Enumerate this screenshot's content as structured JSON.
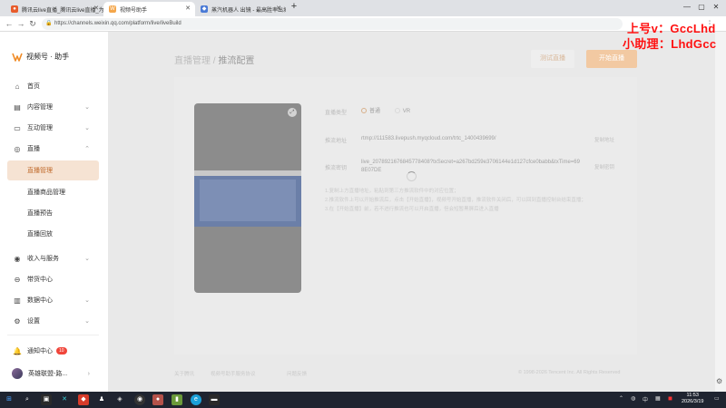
{
  "browser": {
    "tabs": [
      {
        "title": "腾讯云live直播_腾讯云live直播_为",
        "active": false
      },
      {
        "title": "视频号助手",
        "active": true
      },
      {
        "title": "蒸汽机器人 出镜 - 最高胜率出城",
        "active": false
      }
    ],
    "new_tab": "+",
    "url": "https://channels.weixin.qq.com/platform/live/liveBuild"
  },
  "overlay": {
    "line1": "上号v：GccLhd",
    "line2": "小助理：LhdGcc"
  },
  "sidebar": {
    "brand": "视频号 · 助手",
    "items": [
      {
        "label": "首页",
        "icon": "home-icon"
      },
      {
        "label": "内容管理",
        "icon": "content-icon"
      },
      {
        "label": "互动管理",
        "icon": "interaction-icon"
      },
      {
        "label": "直播",
        "icon": "live-icon"
      },
      {
        "label": "收入与服务",
        "icon": "income-icon"
      },
      {
        "label": "带货中心",
        "icon": "shop-icon"
      },
      {
        "label": "数据中心",
        "icon": "data-icon"
      },
      {
        "label": "设置",
        "icon": "settings-icon"
      }
    ],
    "live_sub": [
      "直播管理",
      "直播商品管理",
      "直播预告",
      "直播回放"
    ],
    "notice": {
      "label": "通知中心",
      "count": "10"
    },
    "user": "英雄联盟-路..."
  },
  "main": {
    "breadcrumb_parent": "直播管理",
    "breadcrumb_sep": "/",
    "breadcrumb_current": "推流配置",
    "test_button": "测试直播",
    "start_button": "开始直播",
    "fields": {
      "type_label": "直播类型",
      "type_normal": "普通",
      "type_vr": "VR",
      "server_label": "推流地址",
      "server_value": "rtmp://111583.livepush.myqcloud.com/trtc_1400439699/",
      "key_label": "推流密钥",
      "key_value": "live_2078921676845778408?txSecret=a267bd259e3706144e1d127cfce0babb&txTime=698E07DE",
      "copy": "复制地址",
      "copy_key": "复制密钥"
    },
    "notes": [
      "1.复制上方直播地址，粘贴到第三方推流软件中的对应位置；",
      "2.推流软件上可以开始推流后，点击【开始直播】，视频号开始直播，推流软件关闭后，可以回到直播控制台结束直播；",
      "3.在【开始直播】前，若不进行推流也可以开启直播，但会短暂黑屏后进入直播"
    ],
    "footer_about": "关于腾讯",
    "footer_agreement": "视频号助手服务协议",
    "footer_help": "问题反馈",
    "footer_copyright": "© 1998-2026 Tencent Inc. All Rights Reserved"
  },
  "taskbar": {
    "time": "11:53",
    "date": "2026/3/19",
    "lang": "中"
  }
}
